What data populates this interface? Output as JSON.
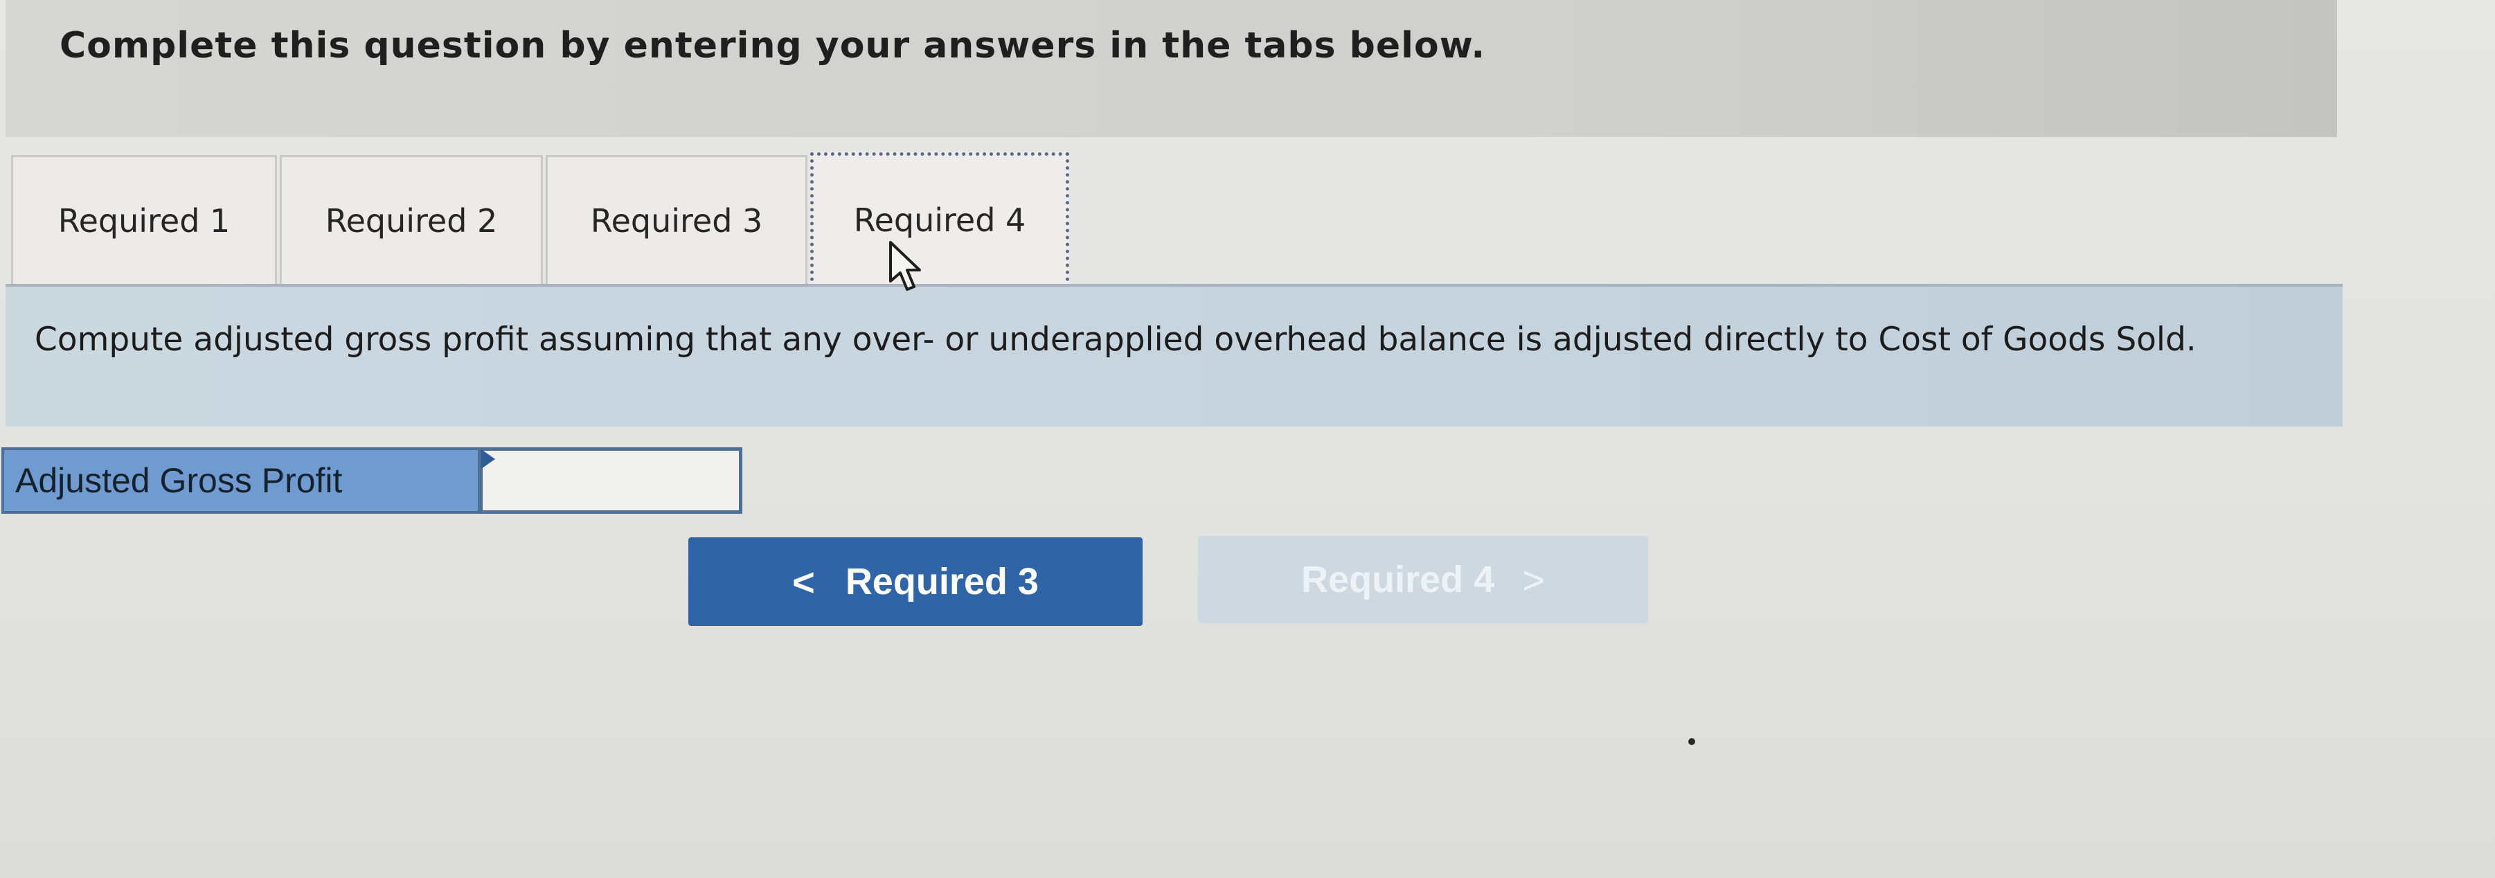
{
  "header": {
    "title": "Complete this question by entering your answers in the tabs below."
  },
  "tabs": [
    {
      "label": "Required 1",
      "active": false
    },
    {
      "label": "Required 2",
      "active": false
    },
    {
      "label": "Required 3",
      "active": false
    },
    {
      "label": "Required 4",
      "active": true
    }
  ],
  "instructions": {
    "text": "Compute adjusted gross profit assuming that any over- or underapplied overhead balance is adjusted directly to Cost of Goods Sold."
  },
  "answer": {
    "label": "Adjusted Gross Profit",
    "value": ""
  },
  "navigation": {
    "prev_label": "Required 3",
    "prev_chevron": "<",
    "next_label": "Required 4",
    "next_chevron": ">",
    "next_enabled": false
  },
  "colors": {
    "header_bg": "#d0d0ce",
    "instructions_bg": "#c6d4de",
    "label_bg": "#6f9bd0",
    "prev_button_bg": "#2f64a6",
    "next_button_bg": "#cdd8e1"
  },
  "icons": {
    "cursor": "mouse-pointer-arrow",
    "prev": "chevron-left-icon",
    "next": "chevron-right-icon"
  }
}
